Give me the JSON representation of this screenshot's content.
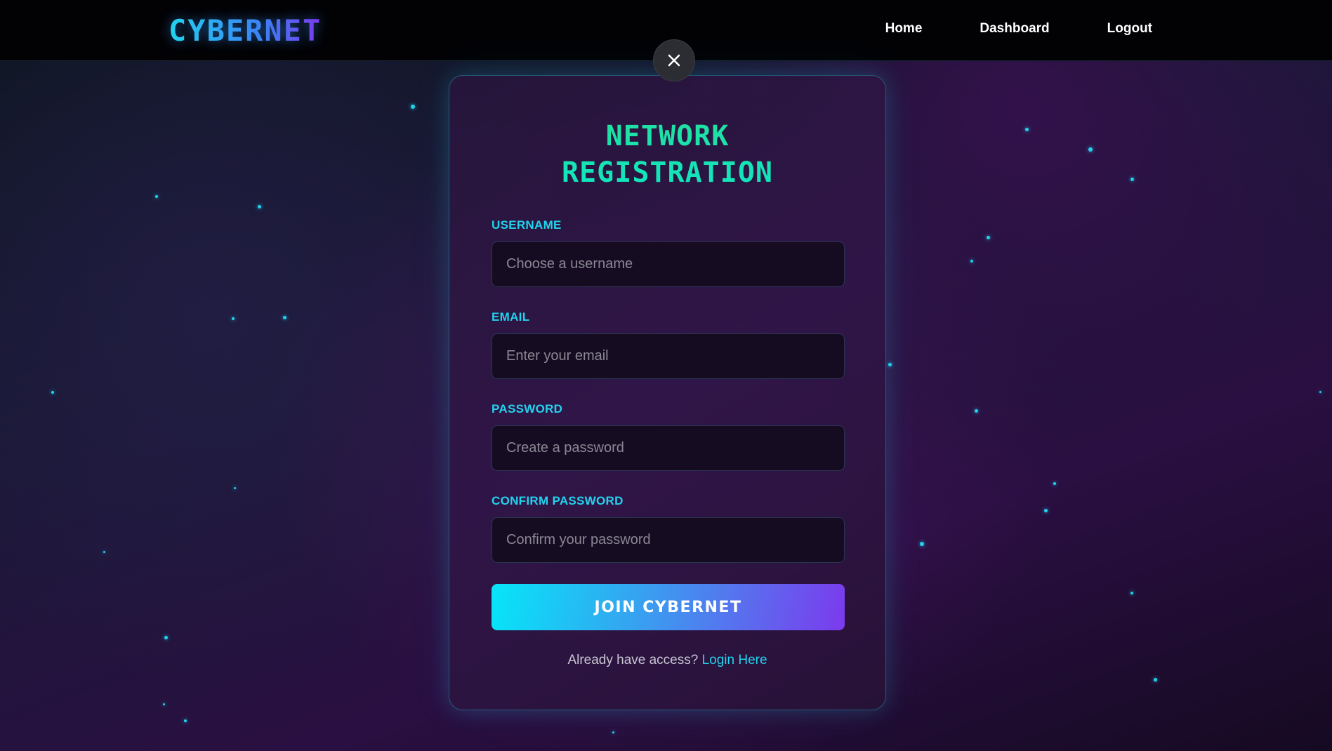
{
  "navbar": {
    "logo": "CYBERNET",
    "links": [
      "Home",
      "Dashboard",
      "Logout"
    ]
  },
  "modal": {
    "close_icon": "close-icon",
    "title_line1": "NETWORK",
    "title_line2": "REGISTRATION",
    "fields": [
      {
        "label": "USERNAME",
        "placeholder": "Choose a username",
        "value": ""
      },
      {
        "label": "EMAIL",
        "placeholder": "Enter your email",
        "value": ""
      },
      {
        "label": "PASSWORD",
        "placeholder": "Create a password",
        "value": ""
      },
      {
        "label": "CONFIRM PASSWORD",
        "placeholder": "Confirm your password",
        "value": ""
      }
    ],
    "submit_label": "JOIN CYBERNET",
    "login_prompt": "Already have access?",
    "login_link": "Login Here"
  },
  "colors": {
    "accent_cyan": "#22d3ee",
    "title_green": "#1fe29b",
    "button_gradient_start": "#06e6f8",
    "button_gradient_end": "#7c3aed",
    "navbar_bg": "#020205"
  }
}
